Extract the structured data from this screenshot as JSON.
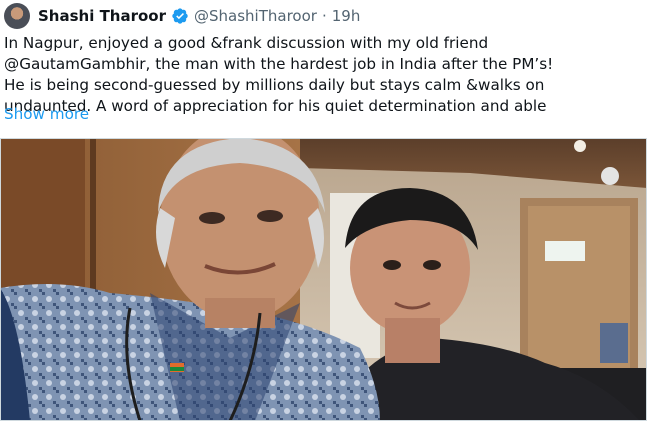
{
  "tweet": {
    "author_name": "Shashi Tharoor",
    "handle": "@ShashiTharoor",
    "separator": "·",
    "time": "19h",
    "text": "In Nagpur, enjoyed a good &frank discussion with my old friend\n@GautamGambhir, the man with the hardest job in India after the PM’s!\nHe is being second-guessed by millions daily but stays calm &walks on\nundaunted. A word of appreciation for his quiet determination and able",
    "show_more": "Show more"
  },
  "icons": {
    "avatar": "profile-avatar",
    "verified": "verified-badge-icon",
    "photo": "tweet-photo"
  },
  "colors": {
    "link": "#1d9bf0",
    "secondary_text": "#536471",
    "verified": "#1d9bf0"
  }
}
